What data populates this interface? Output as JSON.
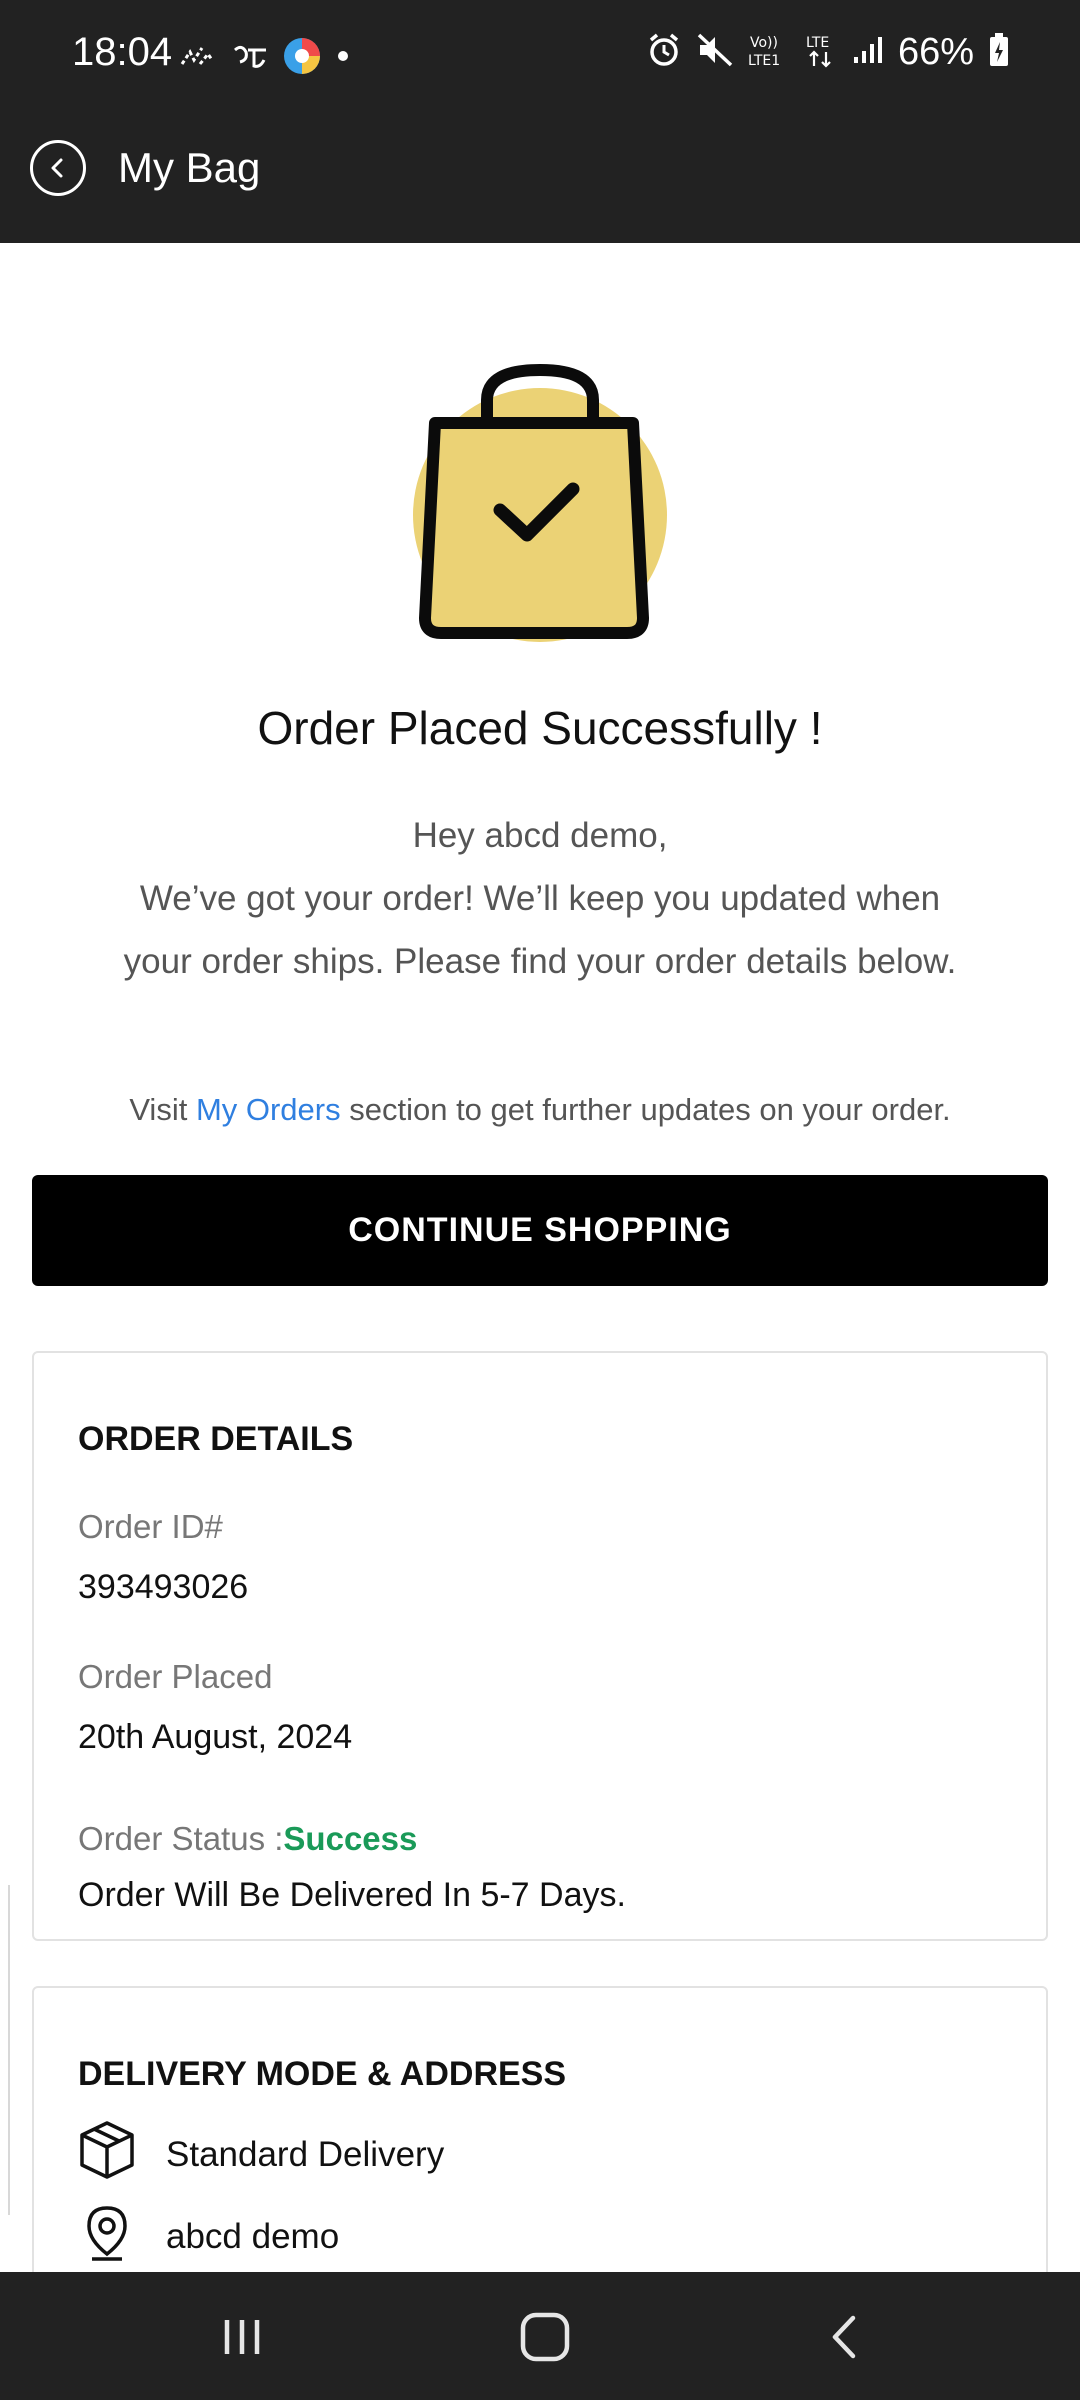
{
  "status_bar": {
    "time": "18:04",
    "battery": "66%",
    "icons": [
      "signal-wave-icon",
      "bengali-script-icon",
      "browser-app-icon",
      "dot-icon",
      "alarm-icon",
      "mute-icon",
      "volte-icon",
      "lte-icon",
      "signal-bars-icon",
      "battery-icon"
    ]
  },
  "app_bar": {
    "title": "My Bag",
    "back_icon": "back-arrow-icon"
  },
  "hero": {
    "icon": "shopping-bag-check-icon",
    "bg_color": "#ebd275"
  },
  "confirmation": {
    "headline": "Order Placed Successfully !",
    "message_line1": "Hey abcd demo,",
    "message_line2": "We’ve got your order! We’ll keep you updated when your order ships. Please find your order details below.",
    "visit_prefix": "Visit ",
    "visit_link": "My Orders",
    "visit_suffix": " section to get further updates on your order."
  },
  "continue_button": {
    "label": "CONTINUE SHOPPING"
  },
  "order_details": {
    "title": "ORDER DETAILS",
    "order_id_label": "Order ID#",
    "order_id": "393493026",
    "placed_label": "Order Placed",
    "placed_date": "20th August, 2024",
    "status_label": "Order Status :",
    "status_value": "Success",
    "delivery_note": "Order Will Be Delivered In 5-7 Days."
  },
  "delivery": {
    "title": "DELIVERY MODE & ADDRESS",
    "mode": "Standard Delivery",
    "name": "abcd demo",
    "mode_icon": "package-icon",
    "name_icon": "location-pin-icon"
  },
  "colors": {
    "header_bg": "#222222",
    "accent_link": "#2f7fe0",
    "success": "#1a9a58",
    "bag_circle": "#ebd275"
  },
  "nav_bar": {
    "items": [
      "recent-apps-icon",
      "home-icon",
      "back-icon"
    ]
  }
}
